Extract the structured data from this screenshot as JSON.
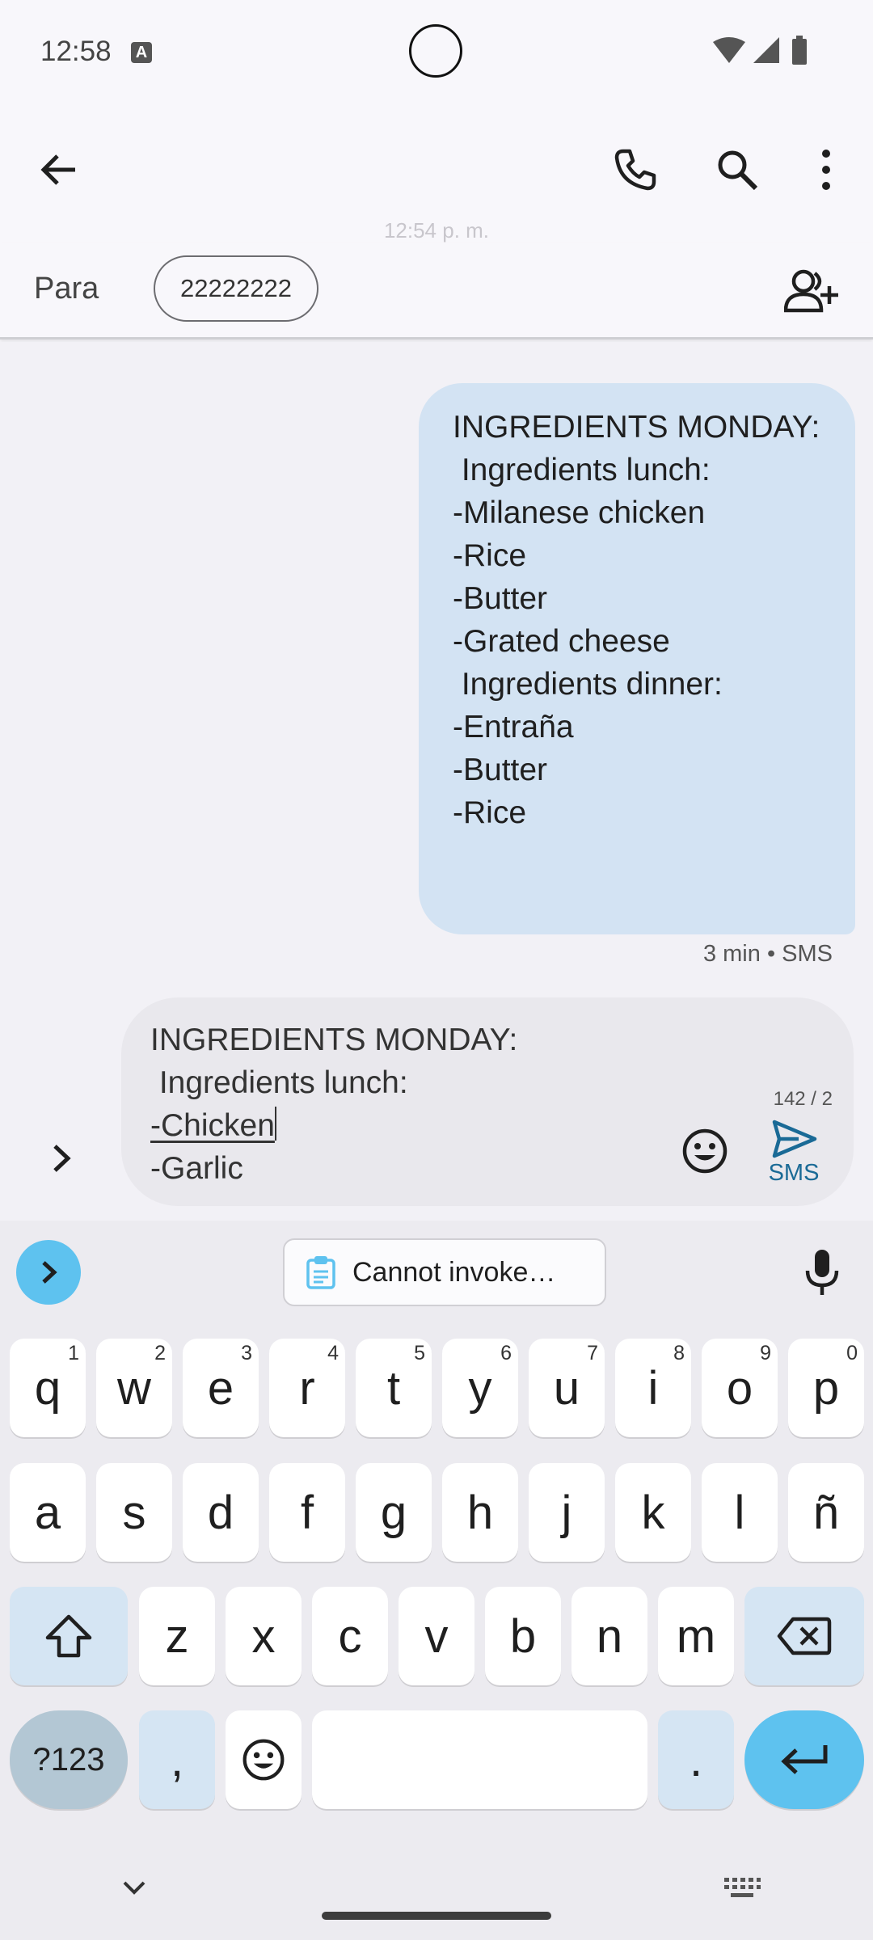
{
  "status_bar": {
    "time": "12:58",
    "a_badge": "A"
  },
  "faded_timestamp": "12:54 p. m.",
  "recipient": {
    "label": "Para",
    "chip": "22222222"
  },
  "message": {
    "lines": [
      "INGREDIENTS MONDAY:",
      " Ingredients lunch:",
      "-Milanese chicken",
      "-Rice",
      "-Butter",
      "-Grated cheese",
      " Ingredients dinner:",
      "-Entraña",
      "-Butter",
      "-Rice"
    ],
    "meta": "3 min • SMS"
  },
  "compose": {
    "line1": "INGREDIENTS MONDAY:",
    "line2": " Ingredients lunch:",
    "line3": "-Chicken",
    "line4": "-Garlic",
    "counter": "142 / 2",
    "send_label": "SMS"
  },
  "keyboard": {
    "clipboard_text": "Cannot invoke…",
    "row1": [
      {
        "key": "q",
        "hint": "1"
      },
      {
        "key": "w",
        "hint": "2"
      },
      {
        "key": "e",
        "hint": "3"
      },
      {
        "key": "r",
        "hint": "4"
      },
      {
        "key": "t",
        "hint": "5"
      },
      {
        "key": "y",
        "hint": "6"
      },
      {
        "key": "u",
        "hint": "7"
      },
      {
        "key": "i",
        "hint": "8"
      },
      {
        "key": "o",
        "hint": "9"
      },
      {
        "key": "p",
        "hint": "0"
      }
    ],
    "row2": [
      "a",
      "s",
      "d",
      "f",
      "g",
      "h",
      "j",
      "k",
      "l",
      "ñ"
    ],
    "row3": [
      "z",
      "x",
      "c",
      "v",
      "b",
      "n",
      "m"
    ],
    "sym_label": "?123",
    "comma": ",",
    "period": "."
  },
  "colors": {
    "bubble": "#d3e3f3",
    "accent": "#5ec2ef",
    "send": "#1a6a96"
  }
}
